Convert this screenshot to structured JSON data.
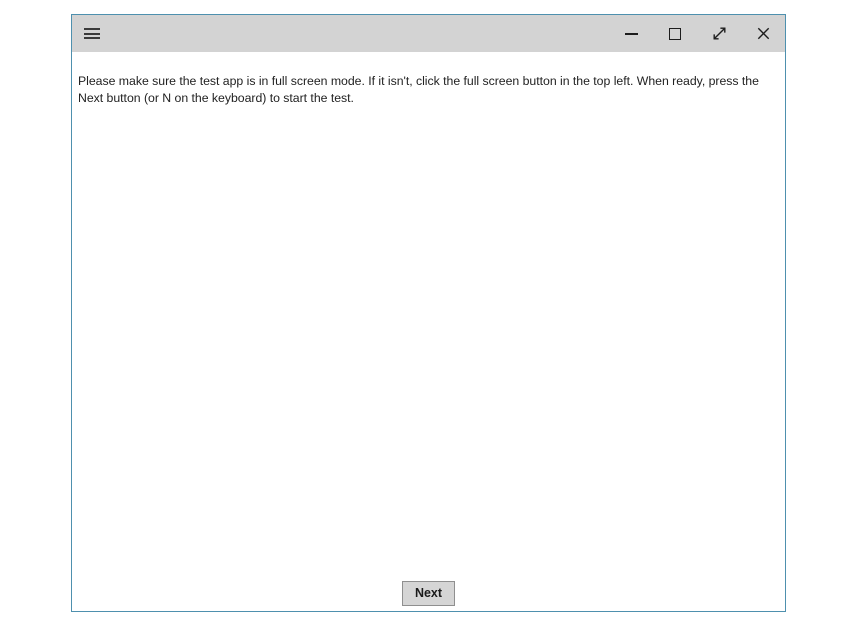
{
  "window": {
    "border_color": "#4e90ae",
    "titlebar_color": "#d3d3d3",
    "background_color": "#ffffff"
  },
  "titlebar": {
    "menu_icon": "hamburger-icon",
    "menu_label": "☰",
    "controls": [
      {
        "name": "minimize",
        "icon": "minimize-icon",
        "glyph": "─",
        "title": "Minimize"
      },
      {
        "name": "maximize",
        "icon": "maximize-icon",
        "glyph": "□",
        "title": "Maximize"
      },
      {
        "name": "fullscreen",
        "icon": "fullscreen-diagonal-arrow-icon",
        "glyph": "↗",
        "title": "Full screen"
      },
      {
        "name": "close",
        "icon": "close-icon",
        "glyph": "✕",
        "title": "Close"
      }
    ]
  },
  "content": {
    "instruction": "Please make sure the test app is in full screen mode. If it isn't, click the full screen button in the top left. When ready, press the Next button (or N on the keyboard) to start the test."
  },
  "footer": {
    "next_label": "Next"
  }
}
